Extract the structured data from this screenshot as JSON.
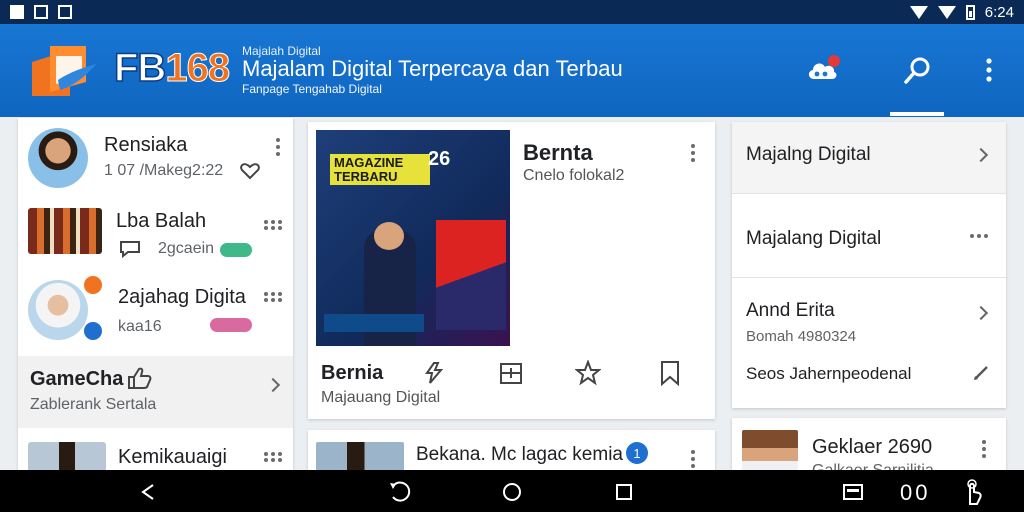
{
  "status_bar": {
    "time": "6:24"
  },
  "app_bar": {
    "brand_prefix": "FB",
    "brand_number": "168",
    "tiny_text": "Majalah Digital",
    "title": "Majalam Digital Terpercaya dan Terbau",
    "subtitle": "Fanpage Tengahab Digital",
    "icons": [
      "cloud-icon",
      "search-icon",
      "more-vert-icon"
    ],
    "colors": {
      "appbar": "#1877d4",
      "accent_orange": "#f07320",
      "status_bar": "#0a2a55"
    }
  },
  "left_list": [
    {
      "name": "Rensiaka",
      "sub": "1 07 /Makeg2:22"
    },
    {
      "name": "Lba Balah",
      "sub": "2gcaein"
    },
    {
      "name": "2ajahag Digita",
      "sub": "kaa16"
    },
    {
      "name": "GameCha",
      "sub": "Zablerank Sertala"
    },
    {
      "name": "Kemikauaigi",
      "sub": ""
    }
  ],
  "middle_card": {
    "poster_title": "MAGAZINE TERBARU",
    "poster_number": "26",
    "title": "Bernta",
    "subtitle": "Cnelo folokal2",
    "name": "Bernia",
    "caption": "Majauang Digital",
    "actions": [
      "recycle-icon",
      "calendar-icon",
      "star-icon",
      "bookmark-icon"
    ]
  },
  "middle_card2": {
    "title": "Bekana. Mc lagac kemia",
    "badge": "1"
  },
  "right_list": [
    {
      "title": "Majalng Digital",
      "sub": ""
    },
    {
      "title": "Majalang Digital",
      "sub": ""
    },
    {
      "title": "Annd Erita",
      "sub": "Bomah 4980324"
    },
    {
      "title": "Seos Jahernpeodenal",
      "sub": ""
    }
  ],
  "right_card2": {
    "title": "Geklaer 2690",
    "sub": "Galkaer Sarnilitia"
  },
  "nav_bar": {
    "extra_text": "00"
  }
}
